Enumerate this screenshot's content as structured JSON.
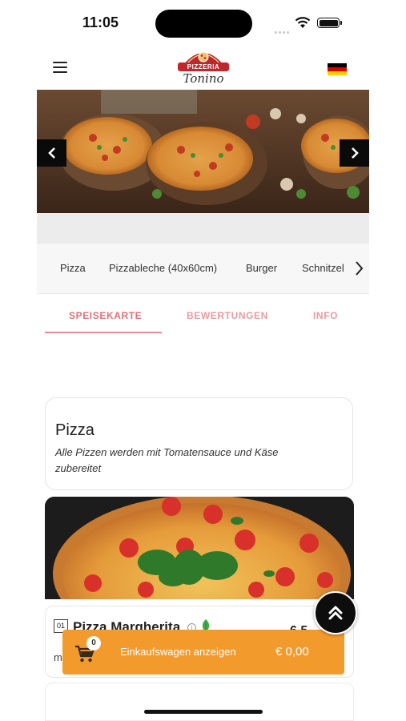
{
  "status_bar": {
    "time": "11:05"
  },
  "header": {
    "logo": {
      "line1": "PIZZERIA",
      "line2": "Tonino"
    },
    "language_flag": "de"
  },
  "categories": [
    "Pizza",
    "Pizzableche (40x60cm)",
    "Burger",
    "Schnitzel"
  ],
  "tabs": [
    {
      "label": "SPEISEKARTE",
      "active": true
    },
    {
      "label": "BEWERTUNGEN",
      "active": false
    },
    {
      "label": "INFO",
      "active": false
    }
  ],
  "section": {
    "title": "Pizza",
    "description": "Alle Pizzen werden mit Tomatensauce und Käse zubereitet"
  },
  "product": {
    "number": "01",
    "name": "Pizza Margherita",
    "price_partial": "6,5",
    "sub_partial": "m"
  },
  "cart": {
    "count": "0",
    "label": "Einkaufswagen anzeigen",
    "total": "€ 0,00"
  },
  "colors": {
    "accent": "#e0707a",
    "cart": "#f39a2c",
    "logo_red": "#c0272d"
  },
  "icons": [
    "menu-icon",
    "flag-de-icon",
    "chevron-left-icon",
    "chevron-right-icon",
    "info-icon",
    "leaf-icon",
    "cart-icon",
    "scroll-top-icon",
    "wifi-icon",
    "battery-icon"
  ]
}
